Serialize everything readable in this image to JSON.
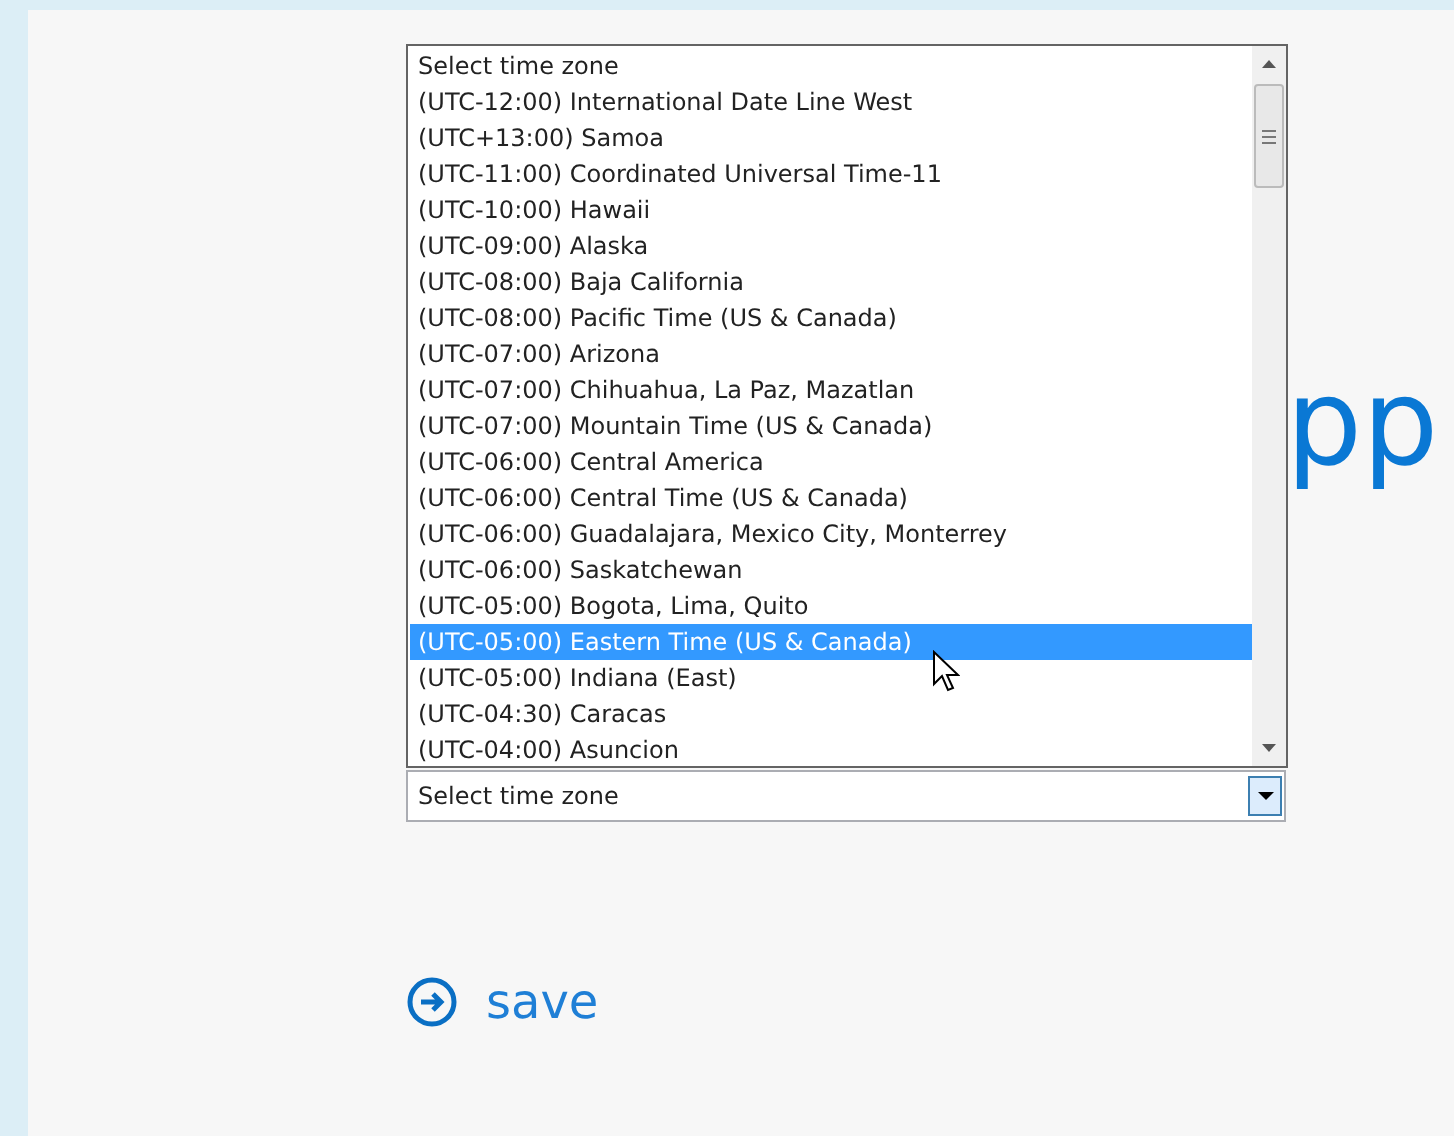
{
  "heading": {
    "text": "pp"
  },
  "timezone_select": {
    "value": "Select time zone",
    "expanded": true
  },
  "timezone_options": [
    {
      "label": "Select time zone",
      "selected": false
    },
    {
      "label": "(UTC-12:00) International Date Line West",
      "selected": false
    },
    {
      "label": "(UTC+13:00) Samoa",
      "selected": false
    },
    {
      "label": "(UTC-11:00) Coordinated Universal Time-11",
      "selected": false
    },
    {
      "label": "(UTC-10:00) Hawaii",
      "selected": false
    },
    {
      "label": "(UTC-09:00) Alaska",
      "selected": false
    },
    {
      "label": "(UTC-08:00) Baja California",
      "selected": false
    },
    {
      "label": "(UTC-08:00) Pacific Time (US & Canada)",
      "selected": false
    },
    {
      "label": "(UTC-07:00) Arizona",
      "selected": false
    },
    {
      "label": "(UTC-07:00) Chihuahua, La Paz, Mazatlan",
      "selected": false
    },
    {
      "label": "(UTC-07:00) Mountain Time (US & Canada)",
      "selected": false
    },
    {
      "label": "(UTC-06:00) Central America",
      "selected": false
    },
    {
      "label": "(UTC-06:00) Central Time (US & Canada)",
      "selected": false
    },
    {
      "label": "(UTC-06:00) Guadalajara, Mexico City, Monterrey",
      "selected": false
    },
    {
      "label": "(UTC-06:00) Saskatchewan",
      "selected": false
    },
    {
      "label": "(UTC-05:00) Bogota, Lima, Quito",
      "selected": false
    },
    {
      "label": "(UTC-05:00) Eastern Time (US & Canada)",
      "selected": true
    },
    {
      "label": "(UTC-05:00) Indiana (East)",
      "selected": false
    },
    {
      "label": "(UTC-04:30) Caracas",
      "selected": false
    },
    {
      "label": "(UTC-04:00) Asuncion",
      "selected": false
    }
  ],
  "save_button": {
    "label": "save"
  }
}
